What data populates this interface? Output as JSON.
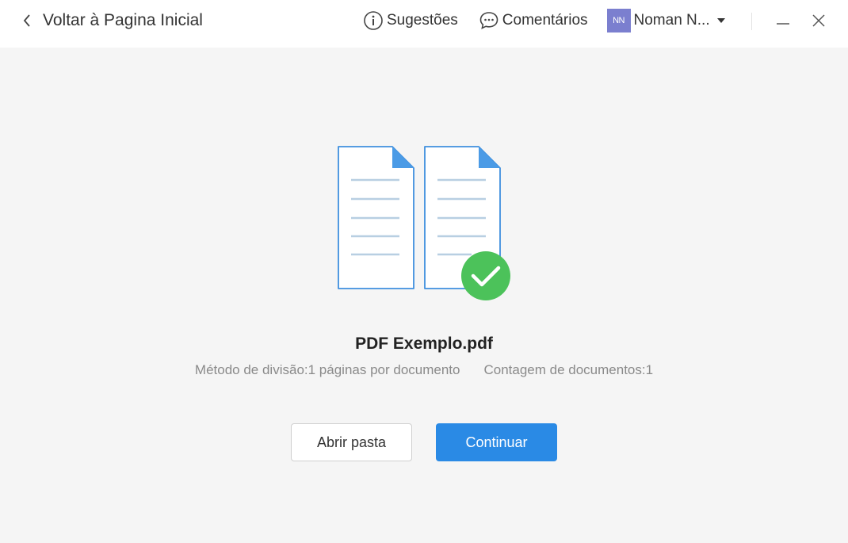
{
  "header": {
    "back_label": "Voltar à Pagina Inicial",
    "suggestions_label": "Sugestões",
    "comments_label": "Comentários",
    "user": {
      "initials": "NN",
      "name": "Noman N..."
    }
  },
  "result": {
    "filename": "PDF Exemplo.pdf",
    "split_method": "Método de divisão:1 páginas por documento",
    "document_count": "Contagem de documentos:1"
  },
  "actions": {
    "open_folder_label": "Abrir pasta",
    "continue_label": "Continuar"
  },
  "colors": {
    "accent": "#2a8ae5",
    "success": "#4cc25a",
    "avatar_bg": "#7b7fcf",
    "doc_outline": "#3f8fde",
    "doc_lines": "#b8cfe2"
  },
  "icons": {
    "back": "chevron-left-icon",
    "suggestions": "info-circle-icon",
    "comments": "chat-bubble-icon",
    "user_menu": "caret-down-icon",
    "minimize": "minimize-icon",
    "close": "close-icon",
    "success": "checkmark-circle-icon"
  }
}
